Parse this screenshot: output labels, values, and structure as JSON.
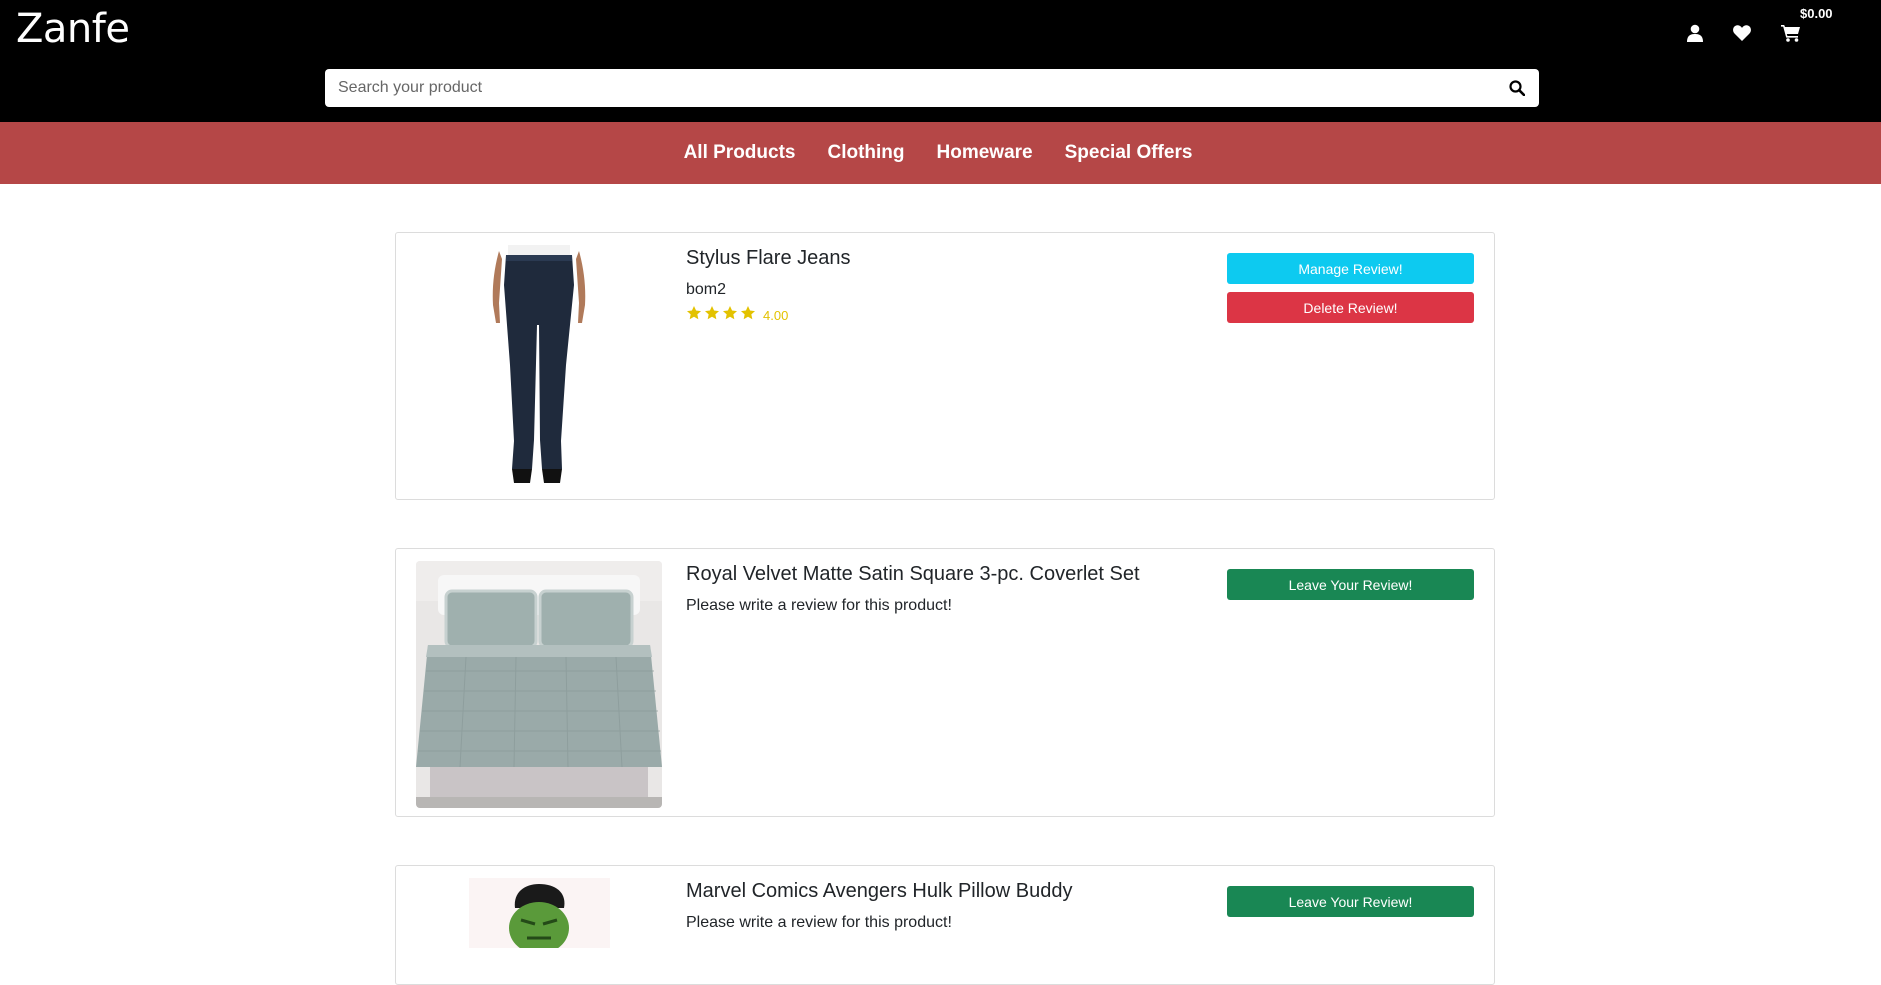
{
  "header": {
    "brand": "Zanfe",
    "cart_total": "$0.00",
    "icons": [
      "user-icon",
      "heart-icon",
      "cart-icon"
    ]
  },
  "search": {
    "placeholder": "Search your product",
    "value": ""
  },
  "nav": {
    "items": [
      "All Products",
      "Clothing",
      "Homeware",
      "Special Offers"
    ]
  },
  "colors": {
    "header_bg": "#000000",
    "nav_bg": "#b54747",
    "manage_button": "#0dcaf0",
    "delete_button": "#dc3545",
    "leave_button": "#198754",
    "star": "#e3c200"
  },
  "reviews": [
    {
      "title": "Stylus Flare Jeans",
      "reviewer": "bom2",
      "stars": 4,
      "rating_text": "4.00",
      "manage_label": "Manage Review!",
      "delete_label": "Delete Review!"
    },
    {
      "title": "Royal Velvet Matte Satin Square 3-pc. Coverlet Set",
      "prompt": "Please write a review for this product!",
      "leave_label": "Leave Your Review!"
    },
    {
      "title": "Marvel Comics Avengers Hulk Pillow Buddy",
      "prompt": "Please write a review for this product!",
      "leave_label": "Leave Your Review!"
    }
  ]
}
